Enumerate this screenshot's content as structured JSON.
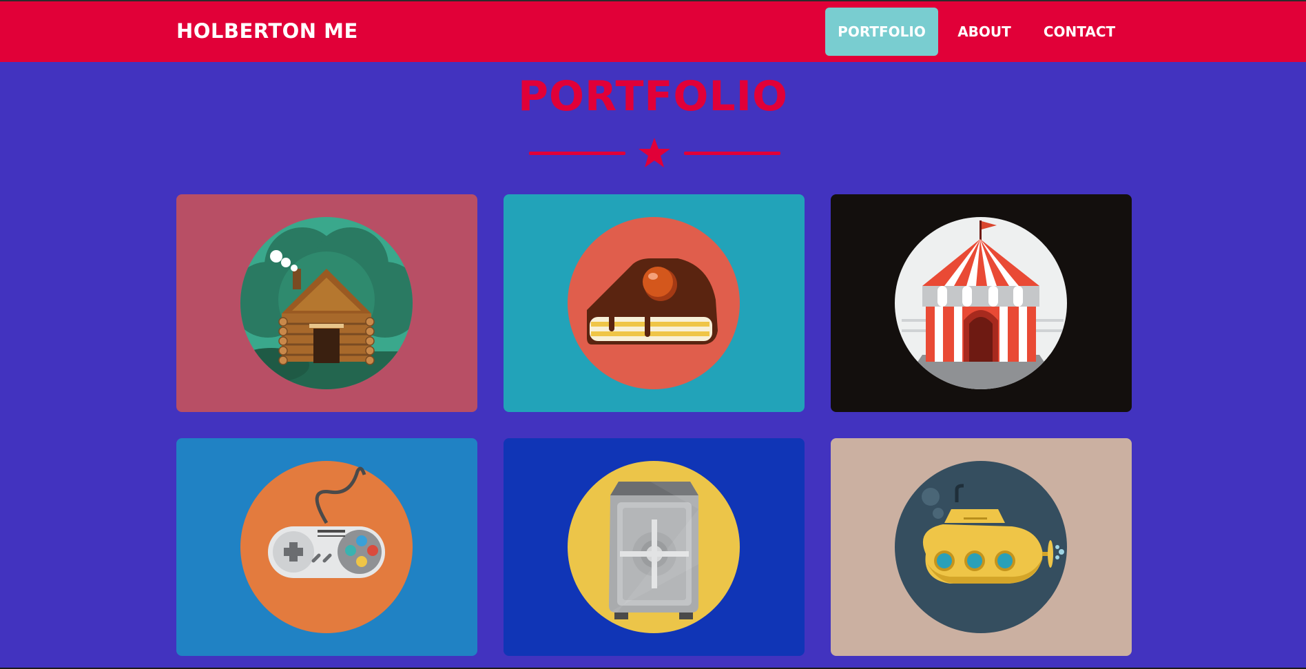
{
  "header": {
    "brand": "HOLBERTON ME",
    "nav": [
      {
        "label": "PORTFOLIO",
        "active": true
      },
      {
        "label": "ABOUT",
        "active": false
      },
      {
        "label": "CONTACT",
        "active": false
      }
    ]
  },
  "portfolio": {
    "title": "PORTFOLIO",
    "divider_icon": "star-icon",
    "items": [
      {
        "icon": "log-cabin-icon",
        "background": "#b84f65",
        "circle": "#3aa88c"
      },
      {
        "icon": "cake-slice-icon",
        "background": "#22a3b9",
        "circle": "#e05e4c"
      },
      {
        "icon": "circus-tent-icon",
        "background": "#130f0d",
        "circle": "#eef0f0"
      },
      {
        "icon": "game-controller-icon",
        "background": "#2082c4",
        "circle": "#e37b3e"
      },
      {
        "icon": "safe-icon",
        "background": "#1035b6",
        "circle": "#ecc549"
      },
      {
        "icon": "submarine-icon",
        "background": "#cbb0a1",
        "circle": "#354e5f"
      }
    ]
  },
  "colors": {
    "page_background": "#4233bf",
    "navbar": "#e10038",
    "active_nav": "#79cdd0",
    "accent": "#e10038"
  }
}
